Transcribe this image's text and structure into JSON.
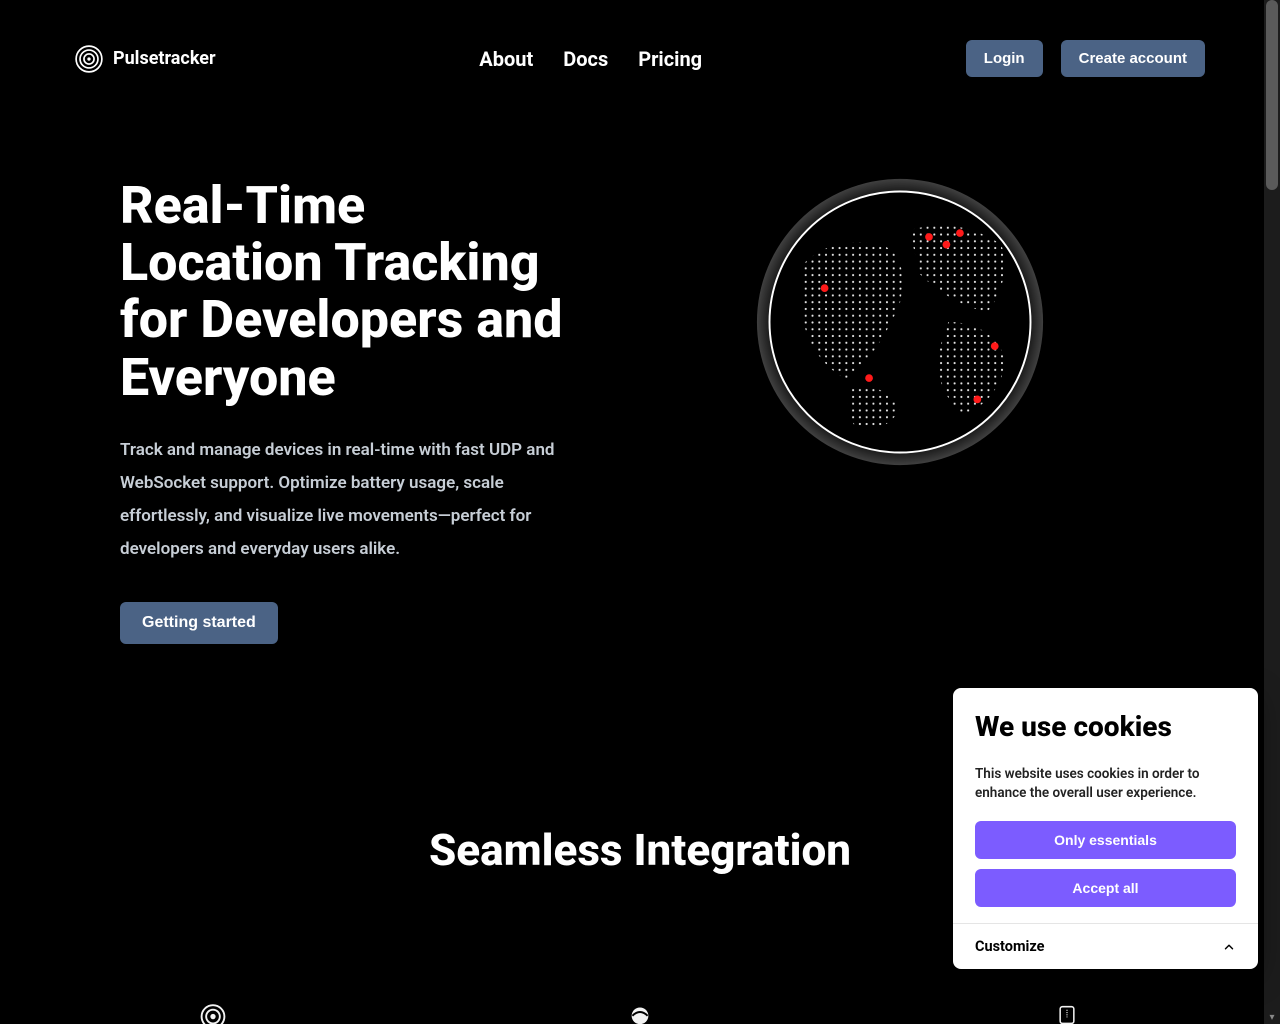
{
  "brand": {
    "name": "Pulsetracker"
  },
  "nav": {
    "about": "About",
    "docs": "Docs",
    "pricing": "Pricing"
  },
  "auth": {
    "login": "Login",
    "create_account": "Create account"
  },
  "hero": {
    "title": "Real-Time Location Tracking for Developers and Everyone",
    "subtitle": "Track and manage devices in real-time with fast UDP and WebSocket support. Optimize battery usage, scale effortlessly, and visualize live movements—perfect for developers and everyday users alike.",
    "cta": "Getting started"
  },
  "section2": {
    "title": "Seamless Integration"
  },
  "cookies": {
    "title": "We use cookies",
    "text": "This website uses cookies in order to enhance the overall user experience.",
    "essentials": "Only essentials",
    "accept_all": "Accept all",
    "customize": "Customize"
  }
}
